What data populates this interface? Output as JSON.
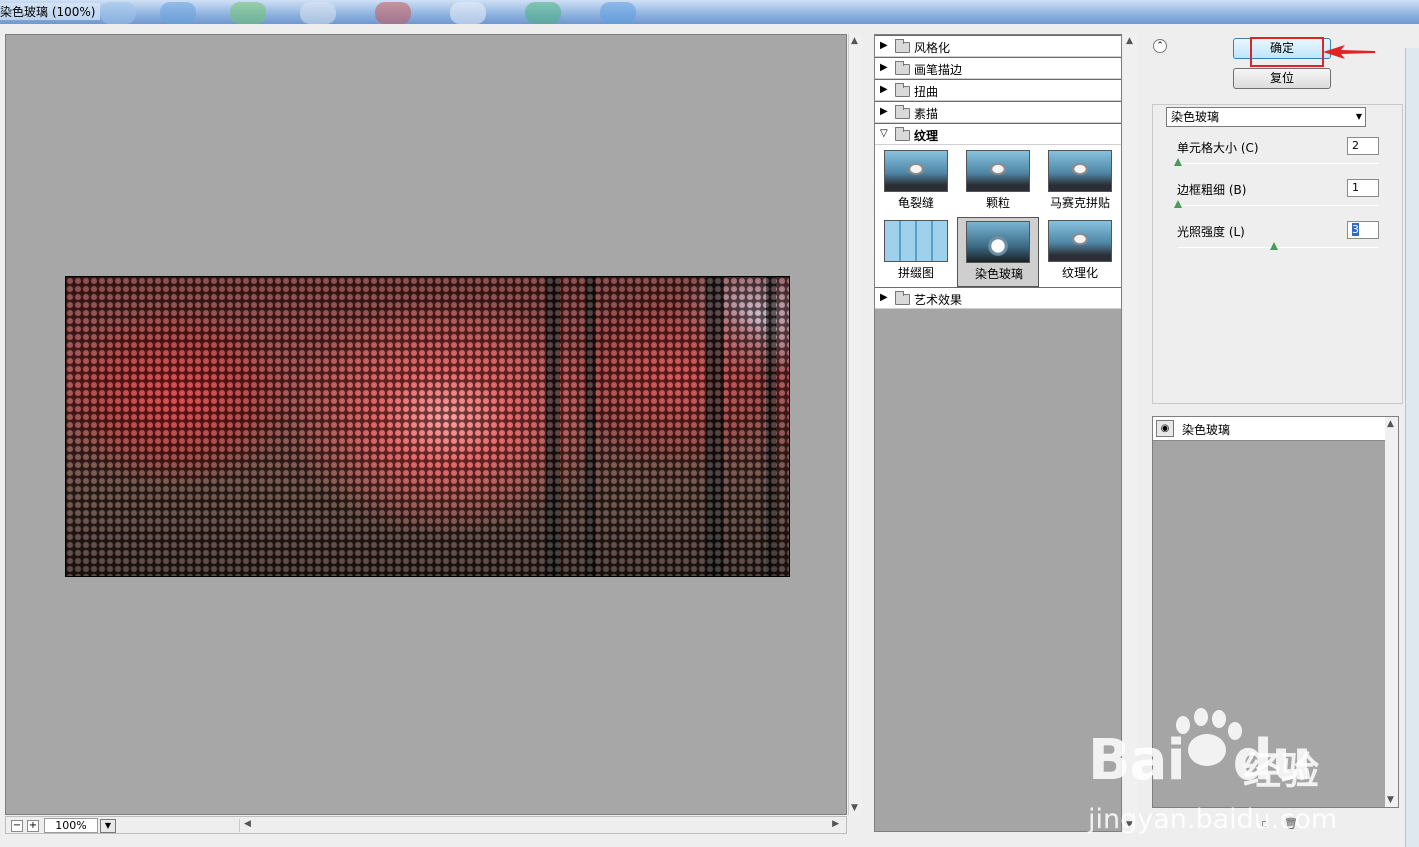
{
  "window": {
    "title": "染色玻璃 (100%)"
  },
  "preview": {
    "zoom": "100%"
  },
  "gallery": {
    "categories": [
      {
        "label": "风格化",
        "expanded": false
      },
      {
        "label": "画笔描边",
        "expanded": false
      },
      {
        "label": "扭曲",
        "expanded": false
      },
      {
        "label": "素描",
        "expanded": false
      },
      {
        "label": "纹理",
        "expanded": true
      },
      {
        "label": "艺术效果",
        "expanded": false
      }
    ],
    "texture_filters": [
      {
        "label": "龟裂缝",
        "selected": false
      },
      {
        "label": "颗粒",
        "selected": false
      },
      {
        "label": "马赛克拼贴",
        "selected": false
      },
      {
        "label": "拼缀图",
        "selected": false
      },
      {
        "label": "染色玻璃",
        "selected": true
      },
      {
        "label": "纹理化",
        "selected": false
      }
    ]
  },
  "actions": {
    "ok_label": "确定",
    "reset_label": "复位"
  },
  "settings": {
    "filter_select": "染色玻璃",
    "params": [
      {
        "label": "单元格大小 (C)",
        "value": "2",
        "level": 0.02
      },
      {
        "label": "边框粗细 (B)",
        "value": "1",
        "level": 0.0
      },
      {
        "label": "光照强度 (L)",
        "value": "3",
        "level": 0.6
      }
    ]
  },
  "layers": {
    "items": [
      {
        "name": "染色玻璃",
        "visible": true
      }
    ]
  },
  "watermark": {
    "brand": "Bai",
    "brand2": "du",
    "cn": "经验",
    "url": "jingyan.baidu.com"
  },
  "colors": {
    "highlight": "#e02424",
    "accent": "#3c7fb1"
  }
}
